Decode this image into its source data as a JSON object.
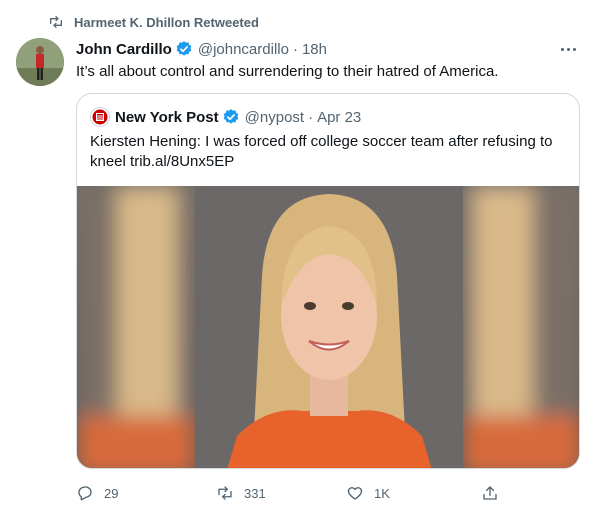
{
  "retweet": {
    "icon": "retweet-icon",
    "label": "Harmeet K. Dhillon Retweeted"
  },
  "tweet": {
    "author_name": "John Cardillo",
    "handle": "@johncardillo",
    "separator": "·",
    "time": "18h",
    "text": "It’s all about control and surrendering to their hatred of America."
  },
  "quote": {
    "author_name": "New York Post",
    "handle": "@nypost",
    "separator": "·",
    "time": "Apr 23",
    "text": "Kiersten Hening: I was forced off college soccer team after refusing to kneel trib.al/8Unx5EP"
  },
  "actions": {
    "reply_count": "29",
    "retweet_count": "331",
    "like_count": "1K"
  },
  "colors": {
    "secondary_text": "#536471",
    "verified": "#1d9bf0",
    "border": "#cfd9de",
    "nypost_red": "#cc0000"
  }
}
